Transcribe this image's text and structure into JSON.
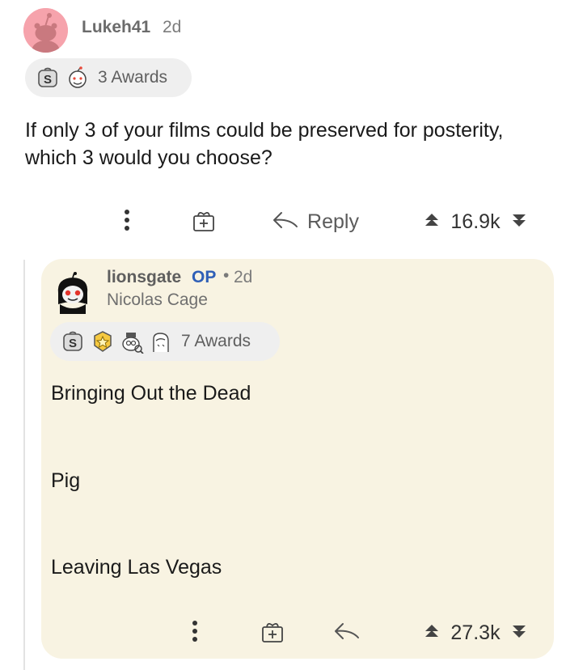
{
  "top_comment": {
    "author": "Lukeh41",
    "time": "2d",
    "awards_text": "3 Awards",
    "body": "If only 3 of your films could be preserved for posterity, which 3 would you choose?",
    "actions": {
      "reply_label": "Reply",
      "score": "16.9k"
    }
  },
  "reply_comment": {
    "author": "lionsgate",
    "op_label": "OP",
    "separator": "•",
    "time": "2d",
    "flair": "Nicolas Cage",
    "awards_text": "7 Awards",
    "lines": [
      "Bringing Out the Dead",
      "Pig",
      "Leaving Las Vegas"
    ],
    "actions": {
      "score": "27.3k"
    }
  },
  "icons": {
    "more": "more-options-icon",
    "gift": "gift-award-icon",
    "reply": "reply-arrow-icon",
    "upvote": "upvote-icon",
    "downvote": "downvote-icon"
  },
  "colors": {
    "reply_card_bg": "#f8f3e2",
    "op_blue": "#2f5fb7",
    "avatar_pink": "#f6a3ac"
  }
}
